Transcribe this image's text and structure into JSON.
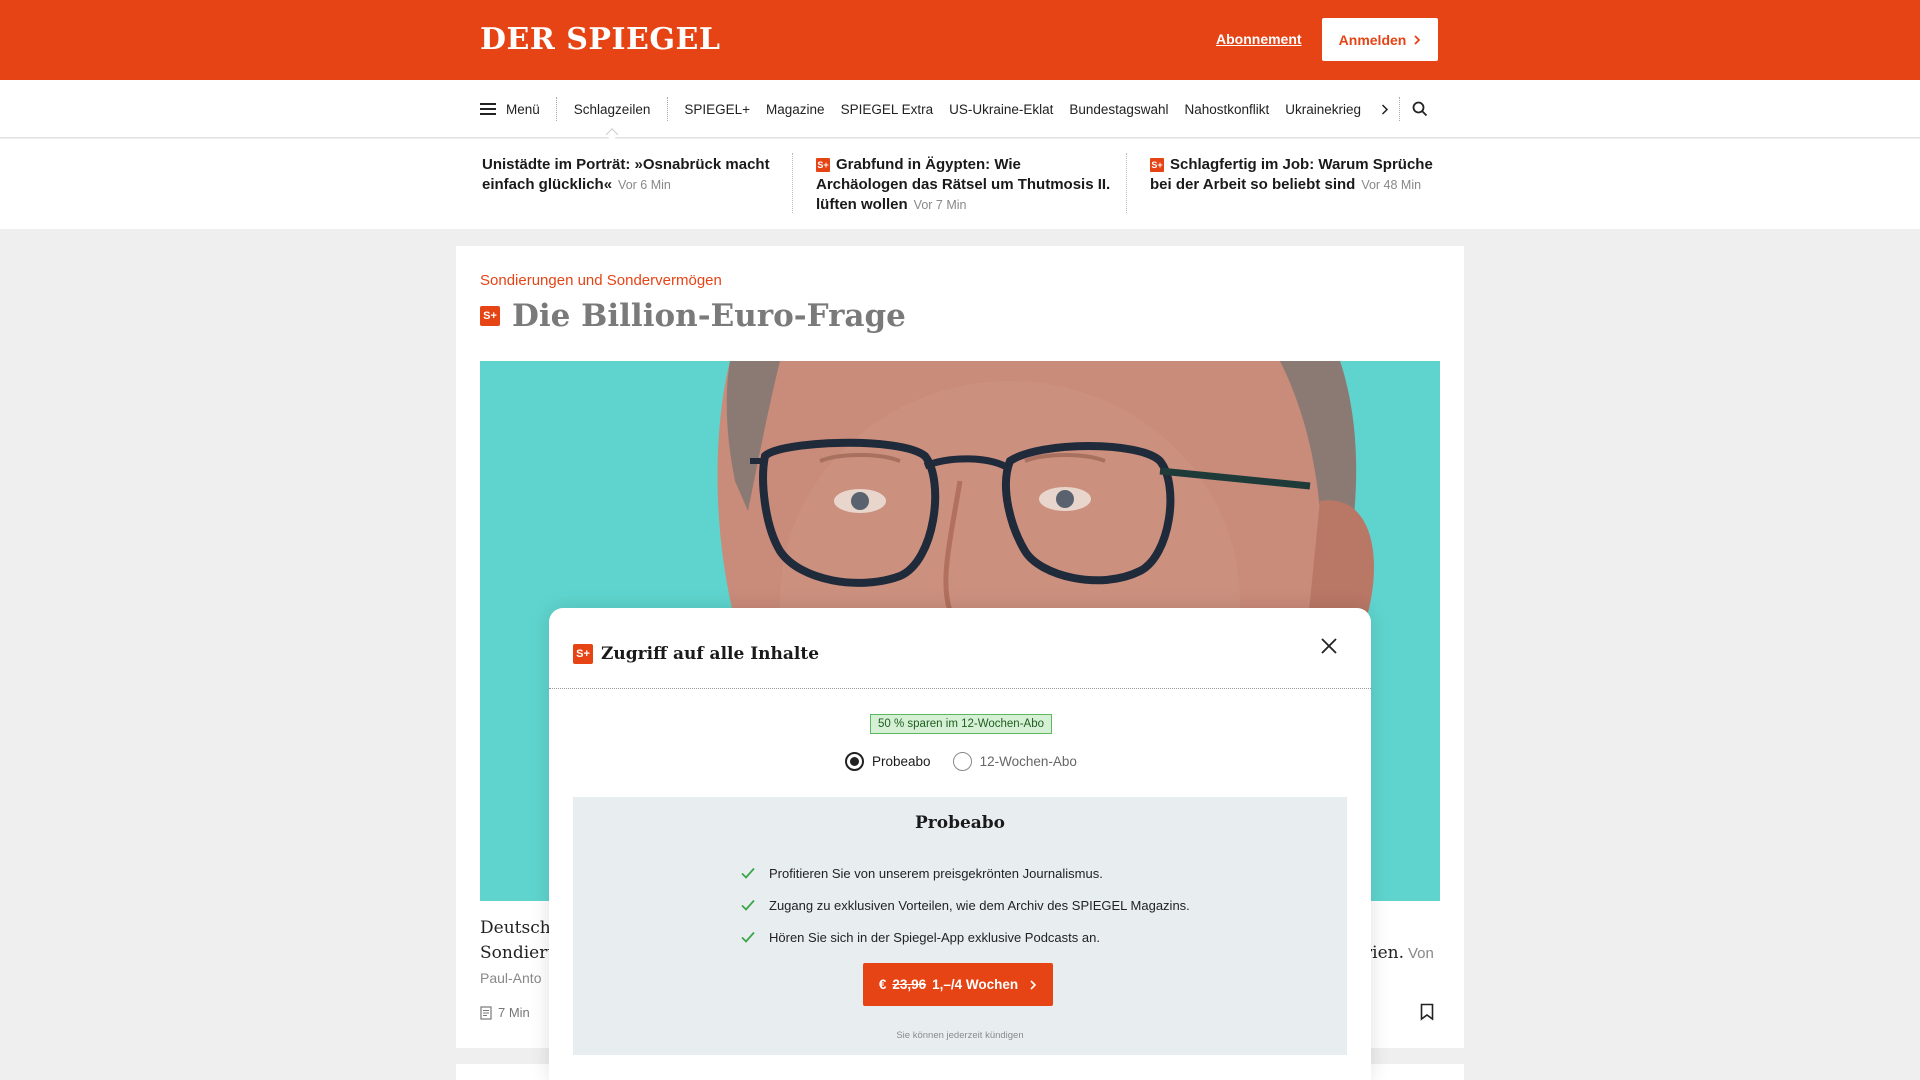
{
  "header": {
    "logo": "DER SPIEGEL",
    "subscription_link": "Abonnement",
    "login_button": "Anmelden"
  },
  "nav": {
    "menu_label": "Menü",
    "active_item": "Schlagzeilen",
    "items": [
      "SPIEGEL+",
      "Magazine",
      "SPIEGEL Extra",
      "US-Ukraine-Eklat",
      "Bundestagswahl",
      "Nahostkonflikt",
      "Ukrainekrieg"
    ]
  },
  "teasers": [
    {
      "title": "Unistädte im Porträt: »Osnabrück macht einfach glücklich«",
      "time": "Vor 6 Min",
      "plus": false
    },
    {
      "title": "Grabfund in Ägypten: Wie Archäologen das Rätsel um Thutmosis II. lüften wollen",
      "time": "Vor 7 Min",
      "plus": true
    },
    {
      "title": "Schlagfertig im Job: Warum Sprüche bei der Arbeit so beliebt sind",
      "time": "Vor 48 Min",
      "plus": true
    }
  ],
  "article": {
    "kicker": "Sondierungen und Sondervermögen",
    "headline": "Die Billion-Euro-Frage",
    "plus_badge": "S+",
    "lead_line1": "Deutschl",
    "lead_line2": "Sondieru",
    "lead_right": "rien.",
    "lead_right_by": "Von",
    "author": "Paul-Anto",
    "read_time": "7 Min"
  },
  "modal": {
    "title": "Zugriff auf alle Inhalte",
    "badge": "50 % sparen im 12-Wochen-Abo",
    "options": [
      {
        "label": "Probeabo",
        "selected": true
      },
      {
        "label": "12-Wochen-Abo",
        "selected": false
      }
    ],
    "offer_title": "Probeabo",
    "benefits": [
      "Profitieren Sie von unserem preisgekrönten Journalismus.",
      "Zugang zu exklusiven Vorteilen, wie dem Archiv des SPIEGEL Magazins.",
      "Hören Sie sich in der Spiegel-App exklusive Podcasts an."
    ],
    "cta_currency": "€",
    "cta_old_price": "23,96",
    "cta_new_price": "1,–/4 Wochen",
    "cancel_note": "Sie können jederzeit kündigen"
  },
  "colors": {
    "brand": "#e64415",
    "hero_bg": "#5fd4ce",
    "check": "#3aa547"
  }
}
